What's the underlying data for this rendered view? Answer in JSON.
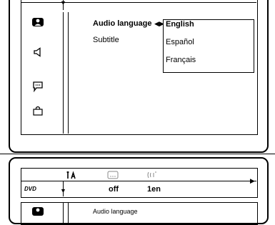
{
  "menu": {
    "items": [
      {
        "label": "Audio language",
        "selected": true
      },
      {
        "label": "Subtitle",
        "selected": false
      }
    ],
    "icons": [
      "person-icon",
      "speaker-icon",
      "speech-bubble-icon",
      "lock-icon"
    ]
  },
  "dropdown": {
    "options": [
      "English",
      "Español",
      "Français"
    ],
    "selected": "English"
  },
  "status_bar": {
    "disc_label": "DVD",
    "subtitle_value": "off",
    "audio_value": "1en"
  },
  "bottom_preview": {
    "label": "Audio language"
  }
}
